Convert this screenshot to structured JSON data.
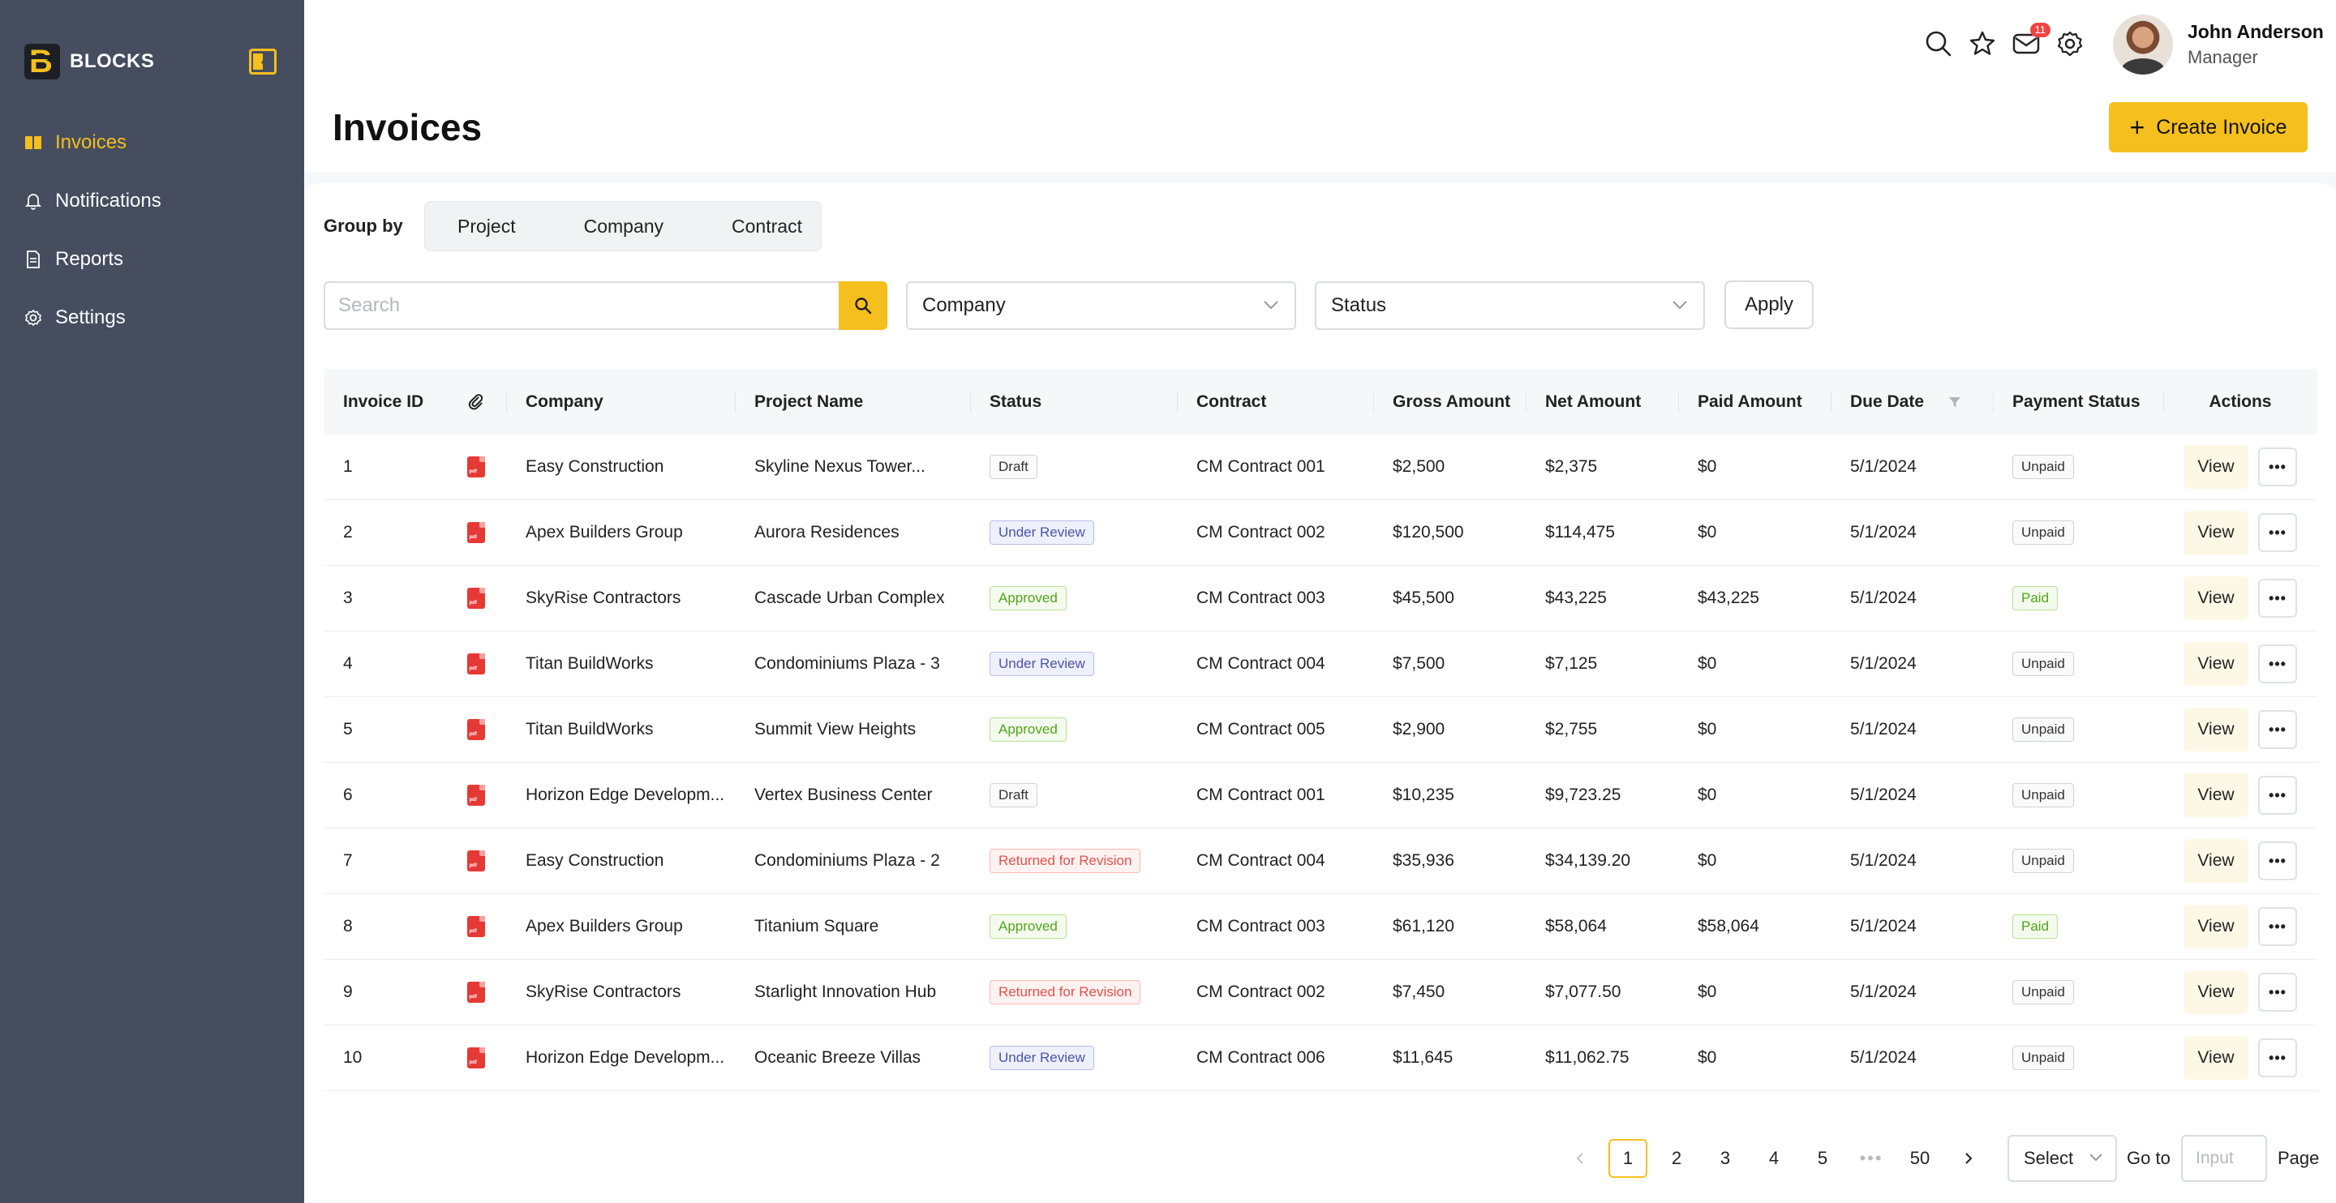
{
  "brand": {
    "name": "BLOCKS",
    "logo_letter": "B"
  },
  "sidebar": {
    "items": [
      {
        "label": "Invoices",
        "icon": "book-icon",
        "active": true
      },
      {
        "label": "Notifications",
        "icon": "bell-icon",
        "active": false
      },
      {
        "label": "Reports",
        "icon": "document-icon",
        "active": false
      },
      {
        "label": "Settings",
        "icon": "gear-icon",
        "active": false
      }
    ]
  },
  "topbar": {
    "mail_badge": "11",
    "user": {
      "name": "John Anderson",
      "role": "Manager"
    }
  },
  "page": {
    "title": "Invoices",
    "create_button": "Create Invoice"
  },
  "group_by": {
    "label": "Group by",
    "options": [
      "Project",
      "Company",
      "Contract"
    ]
  },
  "filters": {
    "search_placeholder": "Search",
    "company_select": "Company",
    "status_select": "Status",
    "apply": "Apply"
  },
  "table": {
    "columns": [
      "Invoice ID",
      "",
      "Company",
      "Project Name",
      "Status",
      "Contract",
      "Gross Amount",
      "Net Amount",
      "Paid Amount",
      "Due Date",
      "Payment Status",
      "Actions"
    ],
    "view_label": "View",
    "more_label": "•••",
    "rows": [
      {
        "id": "1",
        "company": "Easy Construction",
        "project": "Skyline Nexus Tower...",
        "status": "Draft",
        "status_kind": "draft",
        "contract": "CM Contract 001",
        "gross": "$2,500",
        "net": "$2,375",
        "paid": "$0",
        "due": "5/1/2024",
        "payment": "Unpaid",
        "payment_kind": "unpaid"
      },
      {
        "id": "2",
        "company": "Apex Builders Group",
        "project": "Aurora Residences",
        "status": "Under Review",
        "status_kind": "review",
        "contract": "CM Contract 002",
        "gross": "$120,500",
        "net": "$114,475",
        "paid": "$0",
        "due": "5/1/2024",
        "payment": "Unpaid",
        "payment_kind": "unpaid"
      },
      {
        "id": "3",
        "company": "SkyRise Contractors",
        "project": "Cascade Urban Complex",
        "status": "Approved",
        "status_kind": "approved",
        "contract": "CM Contract 003",
        "gross": "$45,500",
        "net": "$43,225",
        "paid": "$43,225",
        "due": "5/1/2024",
        "payment": "Paid",
        "payment_kind": "paid"
      },
      {
        "id": "4",
        "company": "Titan BuildWorks",
        "project": "Condominiums Plaza - 3",
        "status": "Under Review",
        "status_kind": "review",
        "contract": "CM Contract 004",
        "gross": "$7,500",
        "net": "$7,125",
        "paid": "$0",
        "due": "5/1/2024",
        "payment": "Unpaid",
        "payment_kind": "unpaid"
      },
      {
        "id": "5",
        "company": "Titan BuildWorks",
        "project": "Summit View Heights",
        "status": "Approved",
        "status_kind": "approved",
        "contract": "CM Contract 005",
        "gross": "$2,900",
        "net": "$2,755",
        "paid": "$0",
        "due": "5/1/2024",
        "payment": "Unpaid",
        "payment_kind": "unpaid"
      },
      {
        "id": "6",
        "company": "Horizon Edge Developm...",
        "project": "Vertex Business Center",
        "status": "Draft",
        "status_kind": "draft",
        "contract": "CM Contract 001",
        "gross": "$10,235",
        "net": "$9,723.25",
        "paid": "$0",
        "due": "5/1/2024",
        "payment": "Unpaid",
        "payment_kind": "unpaid"
      },
      {
        "id": "7",
        "company": "Easy Construction",
        "project": "Condominiums Plaza - 2",
        "status": "Returned for Revision",
        "status_kind": "revision",
        "contract": "CM Contract 004",
        "gross": "$35,936",
        "net": "$34,139.20",
        "paid": "$0",
        "due": "5/1/2024",
        "payment": "Unpaid",
        "payment_kind": "unpaid"
      },
      {
        "id": "8",
        "company": "Apex Builders Group",
        "project": "Titanium Square",
        "status": "Approved",
        "status_kind": "approved",
        "contract": "CM Contract 003",
        "gross": "$61,120",
        "net": "$58,064",
        "paid": "$58,064",
        "due": "5/1/2024",
        "payment": "Paid",
        "payment_kind": "paid"
      },
      {
        "id": "9",
        "company": "SkyRise Contractors",
        "project": "Starlight Innovation Hub",
        "status": "Returned for Revision",
        "status_kind": "revision",
        "contract": "CM Contract 002",
        "gross": "$7,450",
        "net": "$7,077.50",
        "paid": "$0",
        "due": "5/1/2024",
        "payment": "Unpaid",
        "payment_kind": "unpaid"
      },
      {
        "id": "10",
        "company": "Horizon Edge Developm...",
        "project": "Oceanic Breeze Villas",
        "status": "Under Review",
        "status_kind": "review",
        "contract": "CM Contract 006",
        "gross": "$11,645",
        "net": "$11,062.75",
        "paid": "$0",
        "due": "5/1/2024",
        "payment": "Unpaid",
        "payment_kind": "unpaid"
      }
    ]
  },
  "pagination": {
    "pages": [
      "1",
      "2",
      "3",
      "4",
      "5"
    ],
    "ellipsis": "•••",
    "last_page": "50",
    "current": "1",
    "prev": "‹",
    "next": "›",
    "page_size_select": "Select",
    "goto_label": "Go to",
    "goto_placeholder": "Input",
    "page_label": "Page"
  },
  "colors": {
    "sidebar_bg": "#454d5f",
    "accent": "#f5bf1d"
  }
}
